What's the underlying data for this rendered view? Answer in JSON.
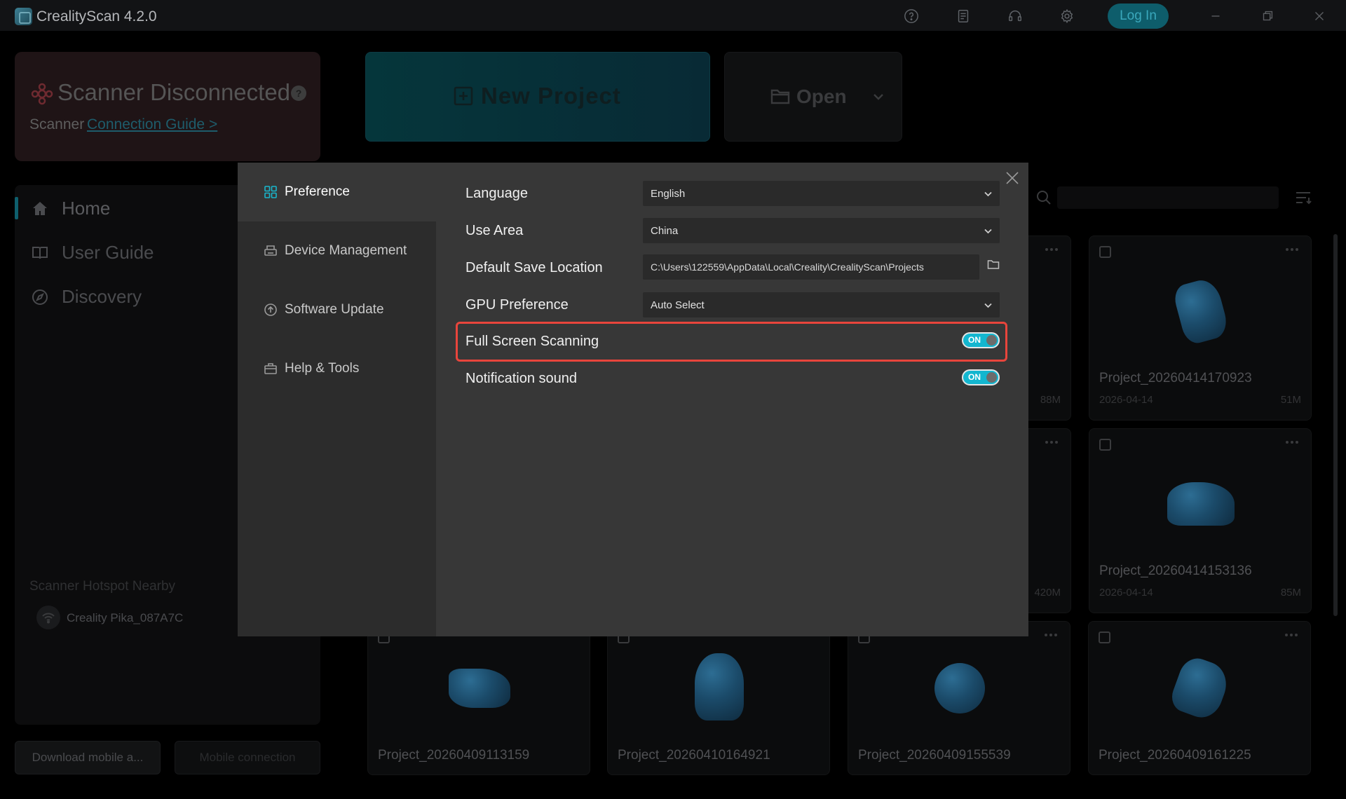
{
  "app": {
    "title": "CrealityScan 4.2.0",
    "login_label": "Log In",
    "colors": {
      "accent": "#13b6cf",
      "highlight": "#e8453c"
    }
  },
  "scanner": {
    "status": "Scanner Disconnected",
    "help": "?",
    "label": "Scanner",
    "guide_link": " Connection Guide >"
  },
  "actions": {
    "new_project": "New Project",
    "open": "Open"
  },
  "nav": {
    "items": [
      {
        "label": "Home",
        "icon": "home-icon",
        "active": true
      },
      {
        "label": "User Guide",
        "icon": "book-icon",
        "active": false
      },
      {
        "label": "Discovery",
        "icon": "compass-icon",
        "active": false
      }
    ]
  },
  "hotspot": {
    "title": "Scanner Hotspot Nearby",
    "device": "Creality Pika_087A7C"
  },
  "bottom": {
    "download": "Download mobile a...",
    "mobile": "Mobile connection"
  },
  "projects": [
    {
      "name": "Project_20260414170923",
      "date": "2026-04-14",
      "size": "51M"
    },
    {
      "name": "Project_20260414153136",
      "date": "2026-04-14",
      "size": "85M"
    },
    {
      "name": "Project_20260409113159"
    },
    {
      "name": "Project_20260410164921"
    },
    {
      "name": "Project_20260409155539"
    },
    {
      "name": "Project_20260409161225"
    }
  ],
  "partial_sizes": [
    "88M",
    "420M"
  ],
  "dialog": {
    "sidebar": [
      {
        "label": "Preference",
        "icon": "grid-icon",
        "active": true
      },
      {
        "label": "Device Management",
        "icon": "printer-icon",
        "active": false
      },
      {
        "label": "Software Update",
        "icon": "update-icon",
        "active": false
      },
      {
        "label": "Help & Tools",
        "icon": "toolbox-icon",
        "active": false
      }
    ],
    "settings": {
      "language": {
        "label": "Language",
        "value": "English"
      },
      "use_area": {
        "label": "Use Area",
        "value": "China"
      },
      "save_location": {
        "label": "Default Save Location",
        "value": "C:\\Users\\122559\\AppData\\Local\\Creality\\CrealityScan\\Projects"
      },
      "gpu": {
        "label": "GPU Preference",
        "value": "Auto Select"
      },
      "full_screen": {
        "label": "Full Screen Scanning",
        "toggle": "ON"
      },
      "notification": {
        "label": "Notification sound",
        "toggle": "ON"
      }
    }
  }
}
